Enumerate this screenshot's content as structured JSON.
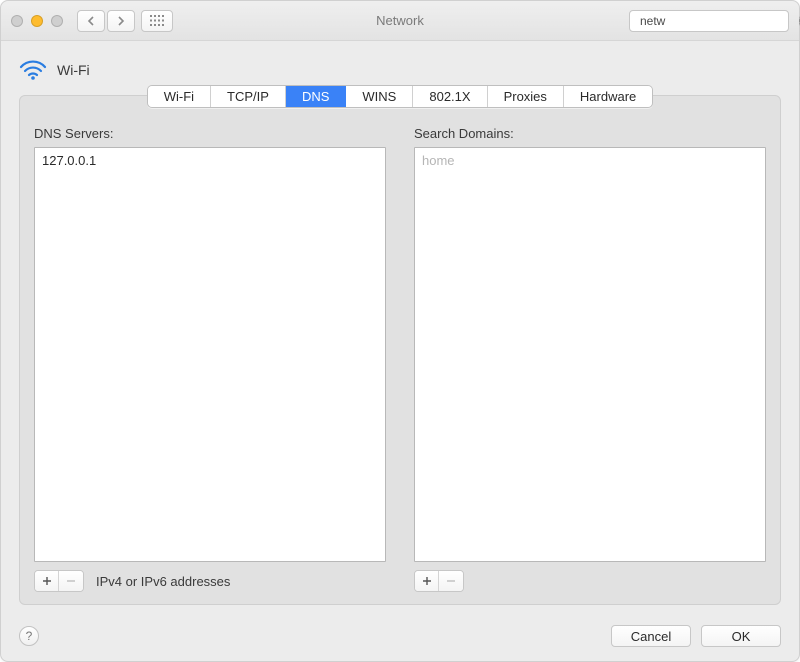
{
  "window": {
    "title": "Network",
    "search": {
      "value": "netw"
    }
  },
  "header": {
    "interface_label": "Wi-Fi"
  },
  "tabs": [
    {
      "id": "wifi",
      "label": "Wi-Fi"
    },
    {
      "id": "tcpip",
      "label": "TCP/IP"
    },
    {
      "id": "dns",
      "label": "DNS"
    },
    {
      "id": "wins",
      "label": "WINS"
    },
    {
      "id": "8021x",
      "label": "802.1X"
    },
    {
      "id": "proxies",
      "label": "Proxies"
    },
    {
      "id": "hardware",
      "label": "Hardware"
    }
  ],
  "active_tab": "dns",
  "dns": {
    "servers_label": "DNS Servers:",
    "servers": [
      "127.0.0.1"
    ],
    "hint": "IPv4 or IPv6 addresses",
    "domains_label": "Search Domains:",
    "domains_placeholder": "home"
  },
  "footer": {
    "cancel_label": "Cancel",
    "ok_label": "OK"
  }
}
